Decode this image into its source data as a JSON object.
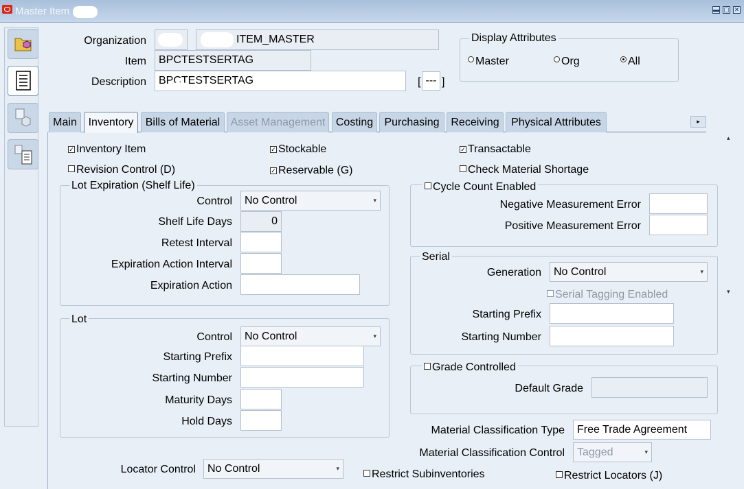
{
  "window": {
    "title": "Master Item (",
    "minimize_glyph": "▬",
    "restore_glyph": "▢",
    "close_glyph": "✕"
  },
  "header": {
    "organization_label": "Organization",
    "organization_code": "",
    "organization_name": "ITEM_MASTER",
    "item_label": "Item",
    "item_value": "BPCTESTSERTAG",
    "description_label": "Description",
    "description_value": "BPCTESTSERTAG",
    "flex_bracket_open": "[",
    "flex_value": "---",
    "flex_bracket_close": "]"
  },
  "display_attributes": {
    "title": "Display Attributes",
    "options": [
      "Master",
      "Org",
      "All"
    ],
    "selected": "All"
  },
  "tabs": [
    {
      "label": "Main",
      "state": "normal"
    },
    {
      "label": "Inventory",
      "state": "active"
    },
    {
      "label": "Bills of Material",
      "state": "normal"
    },
    {
      "label": "Asset Management",
      "state": "disabled"
    },
    {
      "label": "Costing",
      "state": "normal"
    },
    {
      "label": "Purchasing",
      "state": "normal"
    },
    {
      "label": "Receiving",
      "state": "normal"
    },
    {
      "label": "Physical Attributes",
      "state": "normal"
    }
  ],
  "inventory": {
    "inventory_item": {
      "label": "Inventory Item",
      "checked": true
    },
    "stockable": {
      "label": "Stockable",
      "checked": true
    },
    "transactable": {
      "label": "Transactable",
      "checked": true
    },
    "revision_control": {
      "label": "Revision Control (D)",
      "checked": false
    },
    "reservable": {
      "label": "Reservable (G)",
      "checked": true
    },
    "check_material_shortage": {
      "label": "Check Material Shortage",
      "checked": false
    }
  },
  "lot_expiration": {
    "title": "Lot Expiration (Shelf Life)",
    "control_label": "Control",
    "control_value": "No Control",
    "shelf_life_days_label": "Shelf Life Days",
    "shelf_life_days_value": "0",
    "retest_interval_label": "Retest Interval",
    "expiration_action_interval_label": "Expiration Action Interval",
    "expiration_action_label": "Expiration Action"
  },
  "lot": {
    "title": "Lot",
    "control_label": "Control",
    "control_value": "No Control",
    "starting_prefix_label": "Starting Prefix",
    "starting_number_label": "Starting Number",
    "maturity_days_label": "Maturity Days",
    "hold_days_label": "Hold Days"
  },
  "cycle_count": {
    "title": "Cycle Count Enabled",
    "checked": false,
    "negative_label": "Negative Measurement Error",
    "positive_label": "Positive Measurement Error"
  },
  "serial": {
    "title": "Serial",
    "generation_label": "Generation",
    "generation_value": "No Control",
    "tagging_label": "Serial Tagging Enabled",
    "tagging_checked": false,
    "starting_prefix_label": "Starting Prefix",
    "starting_number_label": "Starting Number"
  },
  "grade": {
    "title": "Grade Controlled",
    "checked": false,
    "default_grade_label": "Default Grade"
  },
  "material_classification": {
    "type_label": "Material Classification Type",
    "type_value": "Free Trade Agreement",
    "control_label": "Material Classification Control",
    "control_value": "Tagged"
  },
  "footer": {
    "locator_control_label": "Locator Control",
    "locator_control_value": "No Control",
    "restrict_subinventories_label": "Restrict Subinventories",
    "restrict_subinventories_checked": false,
    "restrict_locators_label": "Restrict Locators (J)",
    "restrict_locators_checked": false
  },
  "icons": {
    "caret": "▾",
    "check": "✓",
    "scroll_right": "▸",
    "scroll_up": "▴",
    "scroll_down": "▾"
  },
  "colors": {
    "background": "#e9eff6",
    "title_bar": "#b4c8e2",
    "oracle_red": "#d8291b"
  }
}
